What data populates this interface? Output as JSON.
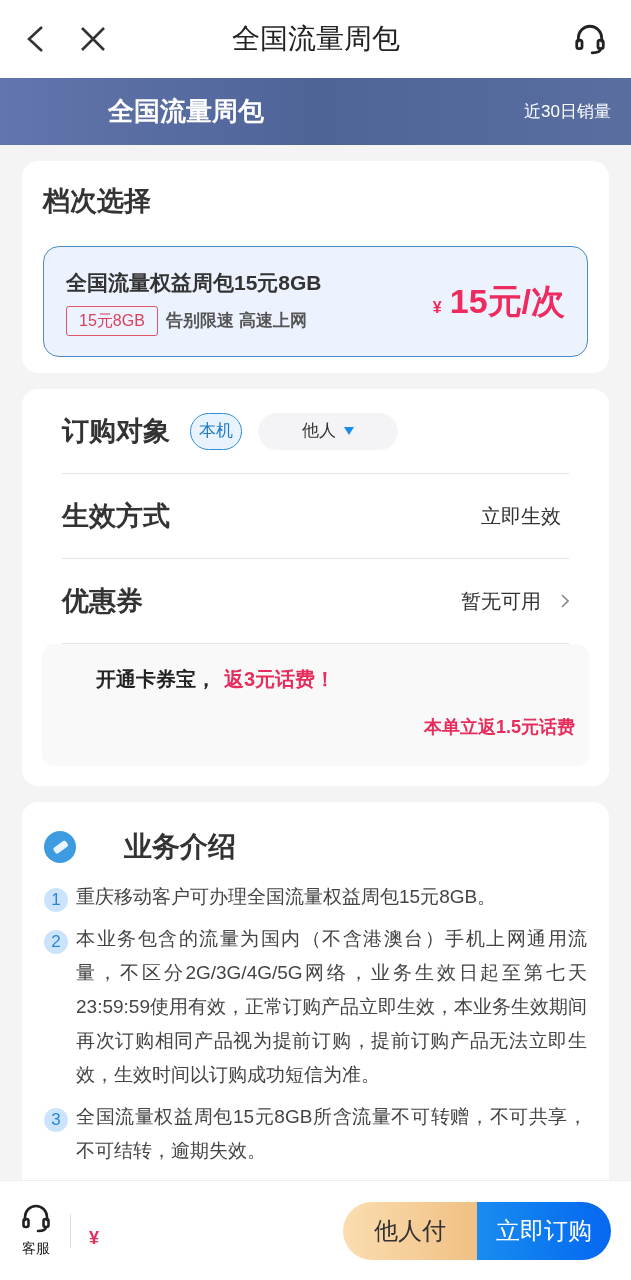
{
  "header": {
    "title": "全国流量周包"
  },
  "banner": {
    "title": "全国流量周包",
    "label": "近30日销量"
  },
  "tier_section": {
    "title": "档次选择",
    "options": [
      {
        "name": "全国流量权益周包15元8GB",
        "tag": "15元8GB",
        "slogan": "告别限速 高速上网",
        "currency": "¥",
        "price": "15元/次",
        "selected": true
      }
    ]
  },
  "order": {
    "target_label": "订购对象",
    "targets": [
      {
        "label": "本机",
        "selected": true
      },
      {
        "label": "他人",
        "selected": false
      }
    ],
    "effect_label": "生效方式",
    "effect_value": "立即生效",
    "coupon_label": "优惠券",
    "coupon_value": "暂无可用"
  },
  "promo": {
    "text": "开通卡券宝，",
    "highlight": "返3元话费！",
    "refund": "本单立返1.5元话费"
  },
  "intro": {
    "title": "业务介绍",
    "items": [
      {
        "number": "1",
        "text": "重庆移动客户可办理全国流量权益周包15元8GB。"
      },
      {
        "number": "2",
        "text": "本业务包含的流量为国内（不含港澳台）手机上网通用流量，不区分2G/3G/4G/5G网络，业务生效日起至第七天23:59:59使用有效，正常订购产品立即生效，本业务生效期间再次订购相同产品视为提前订购，提前订购产品无法立即生效，生效时间以订购成功短信为准。"
      },
      {
        "number": "3",
        "text": "全国流量权益周包15元8GB所含流量不可转赠，不可共享，不可结转，逾期失效。"
      }
    ]
  },
  "footer": {
    "service_label": "客服",
    "currency": "¥",
    "buttons": [
      "他人付",
      "立即订购"
    ]
  }
}
